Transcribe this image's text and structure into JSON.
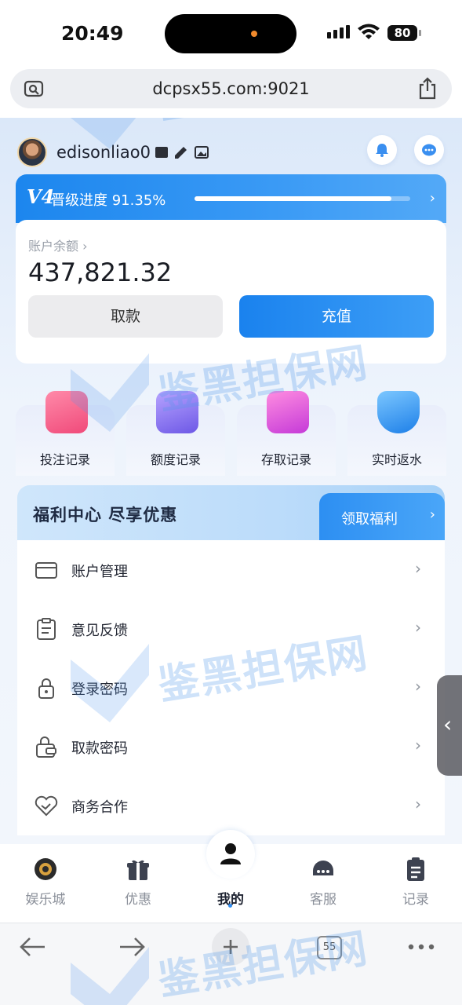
{
  "status_bar": {
    "time": "20:49",
    "battery": "80"
  },
  "browser": {
    "url": "dcpsx55.com:9021",
    "tab_count": "55"
  },
  "profile": {
    "username": "edisonliao0"
  },
  "vip": {
    "level": "V4",
    "progress_label": "晋级进度",
    "progress_percent": "91.35%",
    "progress_fraction": 0.9135
  },
  "balance": {
    "label": "账户余额",
    "amount": "437,821.32",
    "withdraw_label": "取款",
    "deposit_label": "充值"
  },
  "quick_links": [
    {
      "label": "投注记录",
      "icon": "bet-record-icon"
    },
    {
      "label": "额度记录",
      "icon": "quota-record-icon"
    },
    {
      "label": "存取记录",
      "icon": "wallet-record-icon"
    },
    {
      "label": "实时返水",
      "icon": "rebate-shield-icon"
    }
  ],
  "welfare": {
    "title": "福利中心 尽享优惠",
    "button_label": "领取福利"
  },
  "menu": [
    {
      "label": "账户管理",
      "icon": "card-icon"
    },
    {
      "label": "意见反馈",
      "icon": "clipboard-icon"
    },
    {
      "label": "登录密码",
      "icon": "lock-icon"
    },
    {
      "label": "取款密码",
      "icon": "wallet-lock-icon"
    },
    {
      "label": "商务合作",
      "icon": "handshake-heart-icon"
    }
  ],
  "bottom_nav": [
    {
      "label": "娱乐城",
      "icon": "casino-chip-icon"
    },
    {
      "label": "优惠",
      "icon": "gift-icon"
    },
    {
      "label": "我的",
      "icon": "user-icon",
      "active": true
    },
    {
      "label": "客服",
      "icon": "headset-icon"
    },
    {
      "label": "记录",
      "icon": "clipboard-list-icon"
    }
  ],
  "watermark": {
    "text": "鉴黑担保网"
  },
  "colors": {
    "accent": "#1f88f0",
    "brand_gradient_end": "#4aa6f8",
    "background": "#eef3fb"
  }
}
